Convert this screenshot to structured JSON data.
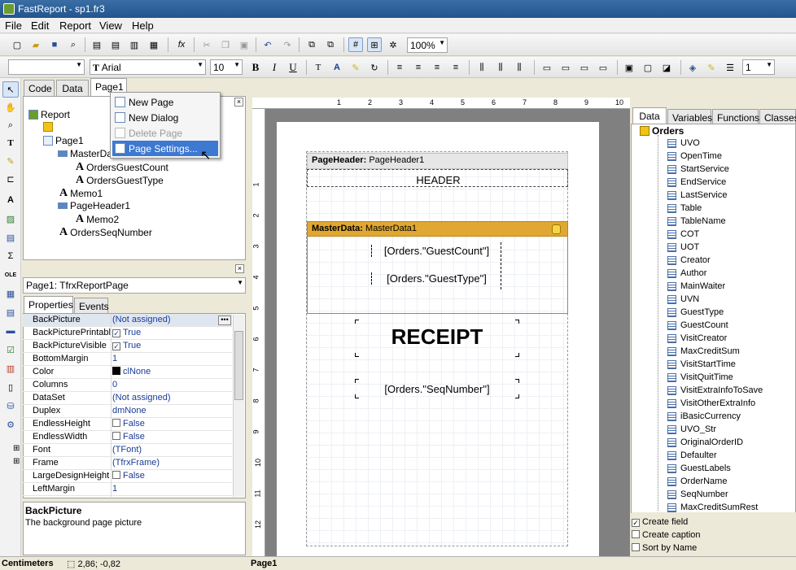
{
  "window": {
    "title": "FastReport - sp1.fr3"
  },
  "menu": [
    "File",
    "Edit",
    "Report",
    "View",
    "Help"
  ],
  "toolbar": {
    "zoom": "100%",
    "font_name": "Arial",
    "font_size": "10",
    "line_width": "1",
    "bold": "B",
    "italic": "I",
    "underline": "U"
  },
  "left_tabs": [
    "Code",
    "Data",
    "Page1"
  ],
  "context_menu": {
    "items": [
      "New Page",
      "New Dialog",
      "Delete Page",
      "Page Settings..."
    ],
    "highlighted": "Page Settings...",
    "disabled": "Delete Page"
  },
  "report_tree": [
    "Report",
    "Page1",
    "MasterData1",
    "OrdersGuestCount",
    "OrdersGuestType",
    "Memo1",
    "PageHeader1",
    "Memo2",
    "OrdersSeqNumber"
  ],
  "object_selector": "Page1: TfrxReportPage",
  "inspector_tabs": [
    "Properties",
    "Events"
  ],
  "properties": [
    {
      "name": "BackPicture",
      "value": "(Not assigned)"
    },
    {
      "name": "BackPicturePrintable",
      "value": "True",
      "check": true
    },
    {
      "name": "BackPictureVisible",
      "value": "True",
      "check": true
    },
    {
      "name": "BottomMargin",
      "value": "1"
    },
    {
      "name": "Color",
      "value": "clNone"
    },
    {
      "name": "Columns",
      "value": "0"
    },
    {
      "name": "DataSet",
      "value": "(Not assigned)"
    },
    {
      "name": "Duplex",
      "value": "dmNone"
    },
    {
      "name": "EndlessHeight",
      "value": "False",
      "check": false
    },
    {
      "name": "EndlessWidth",
      "value": "False",
      "check": false
    },
    {
      "name": "Font",
      "value": "(TFont)",
      "expand": true
    },
    {
      "name": "Frame",
      "value": "(TfrxFrame)",
      "expand": true
    },
    {
      "name": "LargeDesignHeight",
      "value": "False",
      "check": false
    },
    {
      "name": "LeftMargin",
      "value": "1"
    }
  ],
  "description": {
    "title": "BackPicture",
    "text": "The background page picture"
  },
  "ruler_labels": [
    "1",
    "2",
    "3",
    "4",
    "5",
    "6",
    "7",
    "8",
    "9",
    "10"
  ],
  "vruler_labels": [
    "1",
    "2",
    "3",
    "4",
    "5",
    "6",
    "7",
    "8",
    "9",
    "10",
    "11",
    "12"
  ],
  "report": {
    "page_header_label": "PageHeader:",
    "page_header_name": "PageHeader1",
    "header_text": "HEADER",
    "master_label": "MasterData:",
    "master_name": "MasterData1",
    "guest_count": "[Orders.\"GuestCount\"]",
    "guest_type": "[Orders.\"GuestType\"]",
    "receipt": "RECEIPT",
    "seq_number": "[Orders.\"SeqNumber\"]"
  },
  "right_tabs": [
    "Data",
    "Variables",
    "Functions",
    "Classes"
  ],
  "dataset": "Orders",
  "fields": [
    "UVO",
    "OpenTime",
    "StartService",
    "EndService",
    "LastService",
    "Table",
    "TableName",
    "COT",
    "UOT",
    "Creator",
    "Author",
    "MainWaiter",
    "UVN",
    "GuestType",
    "GuestCount",
    "VisitCreator",
    "MaxCreditSum",
    "VisitStartTime",
    "VisitQuitTime",
    "VisitExtraInfoToSave",
    "VisitOtherExtraInfo",
    "iBasicCurrency",
    "UVO_Str",
    "OriginalOrderID",
    "Defaulter",
    "GuestLabels",
    "OrderName",
    "SeqNumber",
    "MaxCreditSumRest"
  ],
  "options": [
    {
      "label": "Create field",
      "checked": true
    },
    {
      "label": "Create caption",
      "checked": false
    },
    {
      "label": "Sort by Name",
      "checked": false
    }
  ],
  "status": {
    "units": "Centimeters",
    "coords": "2,86; -0,82",
    "page": "Page1"
  },
  "colors": {
    "titlebar": "#2a5d97",
    "master_band": "#e0a832",
    "menu_highlight": "#3d78d1"
  }
}
